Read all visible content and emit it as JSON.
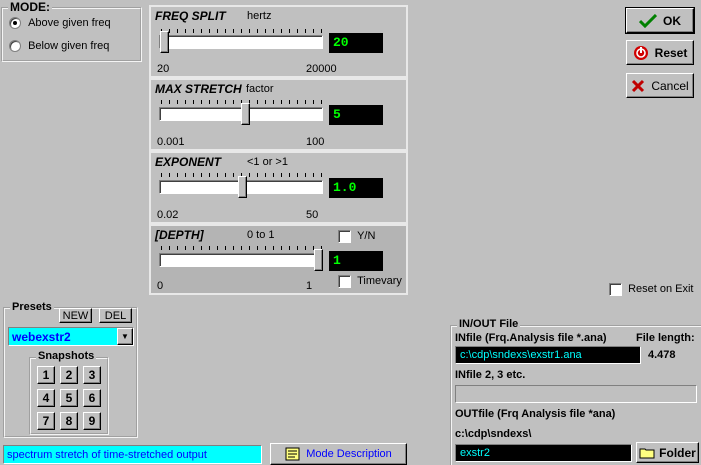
{
  "mode": {
    "title": "MODE:",
    "options": [
      {
        "label": "Above given freq",
        "selected": true
      },
      {
        "label": "Below given freq",
        "selected": false
      }
    ]
  },
  "sliders": {
    "freq_split": {
      "title": "FREQ SPLIT",
      "unit": "hertz",
      "value": "20",
      "min_label": "20",
      "max_label": "20000"
    },
    "max_stretch": {
      "title": "MAX STRETCH",
      "unit": "factor",
      "value": "5",
      "min_label": "0.001",
      "max_label": "100"
    },
    "exponent": {
      "title": "EXPONENT",
      "unit": "<1 or >1",
      "value": "1.0",
      "min_label": "0.02",
      "max_label": "50"
    },
    "depth": {
      "title": "[DEPTH]",
      "unit": "0 to 1",
      "value": "1",
      "min_label": "0",
      "max_label": "1",
      "yn_label": "Y/N",
      "timevary_label": "Timevary"
    }
  },
  "buttons": {
    "ok": "OK",
    "reset": "Reset",
    "cancel": "Cancel"
  },
  "reset_on_exit": "Reset on Exit",
  "presets": {
    "title": "Presets",
    "new": "NEW",
    "del": "DEL",
    "selected": "webexstr2",
    "snapshots_title": "Snapshots",
    "snapshots": [
      "1",
      "2",
      "3",
      "4",
      "5",
      "6",
      "7",
      "8",
      "9"
    ]
  },
  "status_text": "spectrum stretch of time-stretched output",
  "mode_description": "Mode Description",
  "io": {
    "title": "IN/OUT File",
    "infile_label": "INfile (Frq.Analysis file *.ana)",
    "file_length_label": "File length:",
    "file_length_value": "4.478",
    "infile_value": "c:\\cdp\\sndexs\\exstr1.ana",
    "infile2_label": "INfile 2, 3 etc.",
    "infile2_value": "",
    "outfile_label": "OUTfile (Frq Analysis file *ana)",
    "outfile_dir": "c:\\cdp\\sndexs\\",
    "outfile_value": "exstr2",
    "folder": "Folder"
  },
  "colors": {
    "cyan": "#00ffff",
    "green_value": "#00ff00",
    "blue_text": "#0000ff"
  }
}
